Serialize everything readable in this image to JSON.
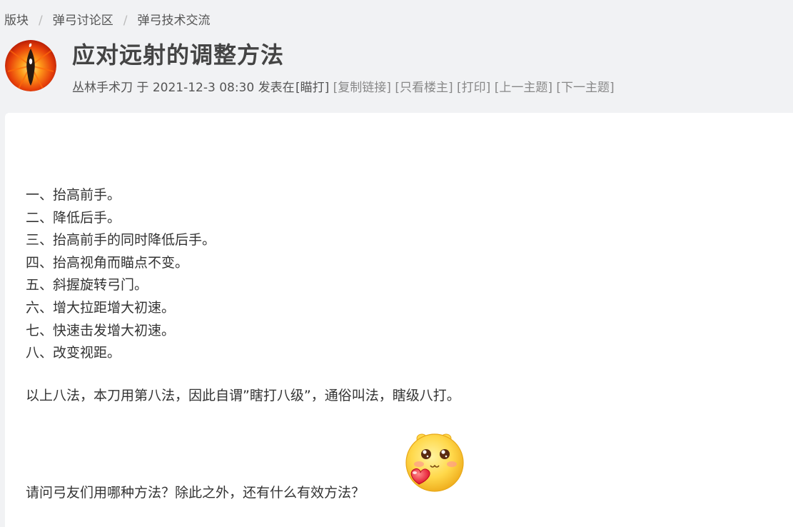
{
  "breadcrumb": {
    "items": [
      "版块",
      "弹弓讨论区",
      "弹弓技术交流"
    ],
    "separator": "/"
  },
  "thread": {
    "title": "应对远射的调整方法",
    "author": "丛林手术刀",
    "posted_prefix": "于",
    "datetime": "2021-12-3 08:30",
    "posted_in": "发表在",
    "category": "[瞄打]",
    "actions": [
      "[复制链接]",
      "[只看楼主]",
      "[打印]",
      "[上一主题]",
      "[下一主题]"
    ]
  },
  "post": {
    "lines": [
      "一、抬高前手。",
      "二、降低后手。",
      "三、抬高前手的同时降低后手。",
      "四、抬高视角而瞄点不变。",
      "五、斜握旋转弓门。",
      "六、增大拉距增大初速。",
      "七、快速击发增大初速。",
      "八、改变视距。"
    ],
    "summary": "以上八法，本刀用第八法，因此自谓”瞎打八级”，通俗叫法，瞎级八打。",
    "question": "请问弓友们用哪种方法？除此之外，还有什么有效方法？",
    "emoji_icon": "smiley-heart-icon"
  },
  "colors": {
    "background": "#f1f2f4",
    "card": "#ffffff",
    "title": "#444444",
    "muted_link": "#888888"
  }
}
